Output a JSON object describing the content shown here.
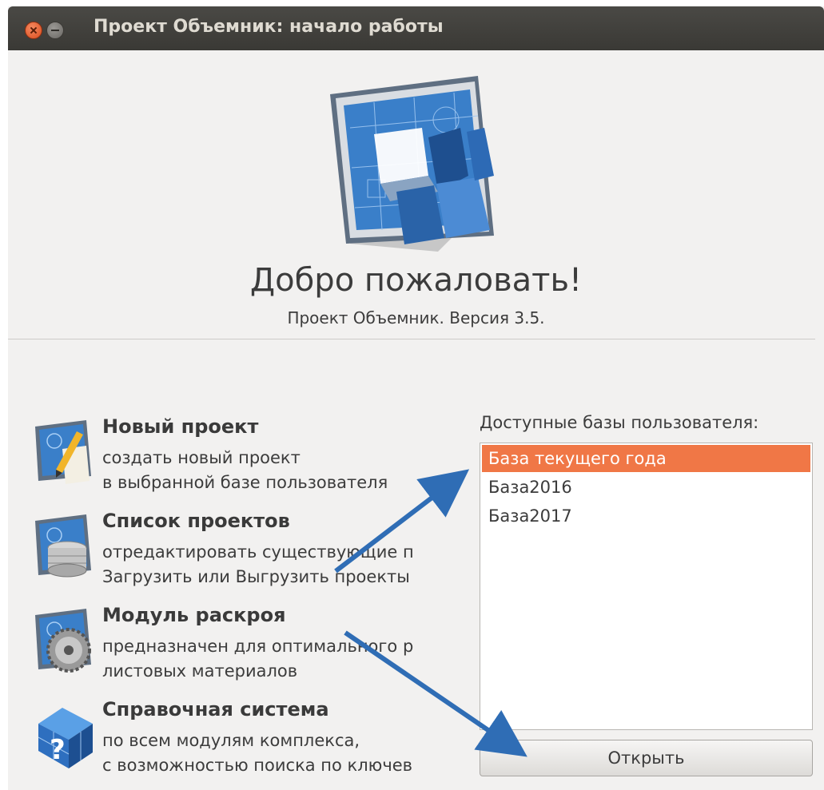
{
  "window": {
    "title": "Проект Объемник: начало работы"
  },
  "header": {
    "welcome": "Добро пожаловать!",
    "version": "Проект Объемник. Версия 3.5."
  },
  "actions": [
    {
      "title": "Новый проект",
      "desc1": "создать новый проект",
      "desc2": "в выбранной базе пользователя",
      "icon": "blueprint-pencil-icon"
    },
    {
      "title": "Список проектов",
      "desc1": "отредактировать существующие п",
      "desc2": "Загрузить или Выгрузить проекты",
      "icon": "blueprint-database-icon"
    },
    {
      "title": "Модуль раскроя",
      "desc1": "предназначен для оптимального р",
      "desc2": "листовых материалов",
      "icon": "blueprint-saw-icon"
    },
    {
      "title": "Справочная система",
      "desc1": "по всем модулям комплекса,",
      "desc2": "с возможностью поиска по ключев",
      "icon": "help-cube-icon"
    }
  ],
  "databases": {
    "label": "Доступные базы пользователя:",
    "items": [
      "База текущего года",
      "База2016",
      "База2017"
    ],
    "selected_index": 0
  },
  "open_button": "Открыть",
  "colors": {
    "selection": "#f07746",
    "titlebar": "#3c3b37",
    "arrow": "#2f6db5"
  }
}
